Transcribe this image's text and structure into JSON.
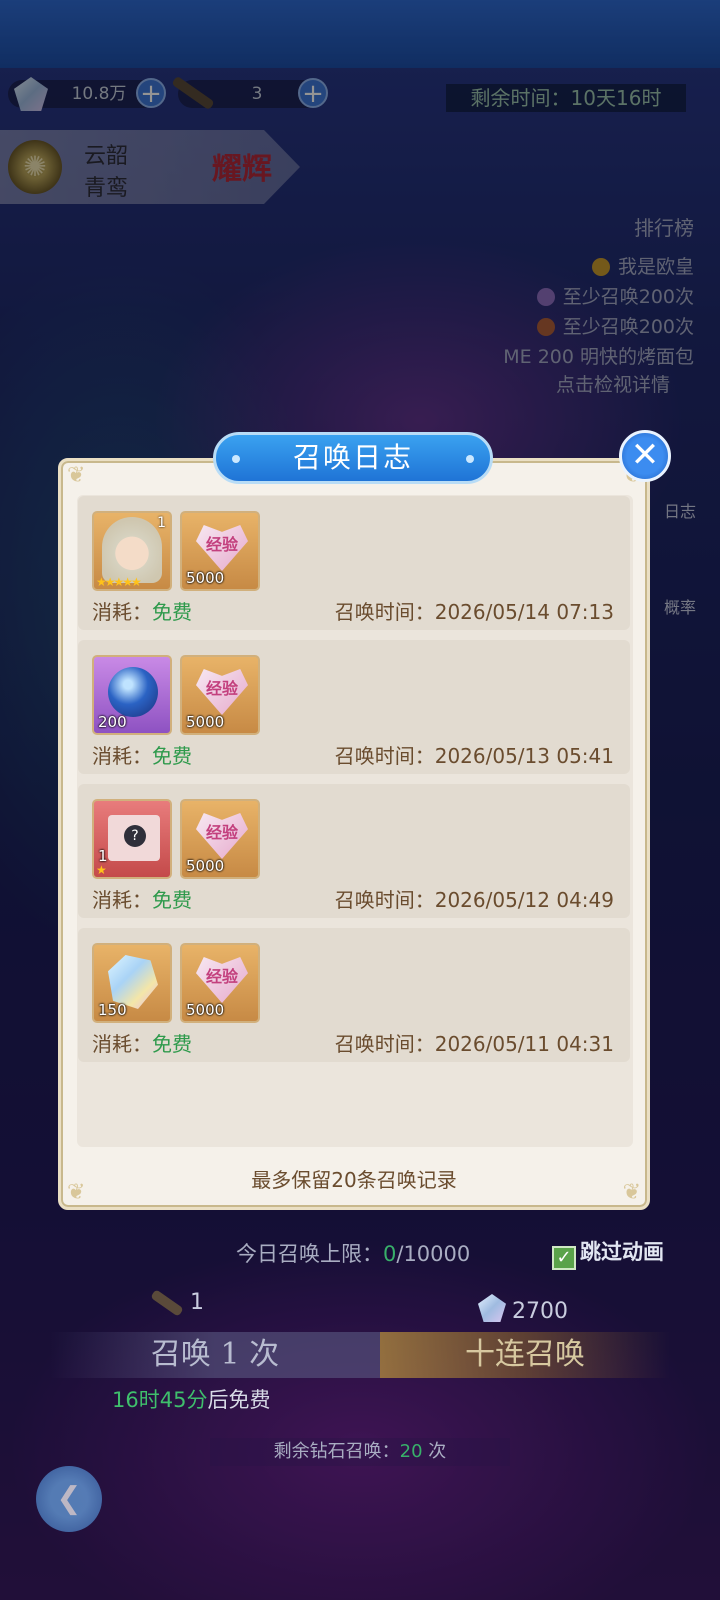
{
  "header": {
    "currency": [
      {
        "icon": "diamond-icon",
        "value": "10.8万"
      },
      {
        "icon": "summon-stick-icon",
        "value": "3"
      }
    ],
    "remaining_time_label": "剩余时间：",
    "remaining_time_value": "10天16时"
  },
  "server": {
    "line1": "云韶",
    "line2": "青鸾",
    "tag": "耀辉"
  },
  "ranking": {
    "title": "排行榜",
    "items": [
      "我是欧皇",
      "至少召唤200次",
      "至少召唤200次"
    ],
    "entry": "ME 200  明快的烤面包",
    "link": "点击检视详情"
  },
  "side_buttons": [
    "日志",
    "概率"
  ],
  "dialog": {
    "title": "召唤日志",
    "cost_label": "消耗：",
    "cost_value": "免费",
    "time_label": "召唤时间：",
    "entries": [
      {
        "items": [
          {
            "icon": "hero-portrait-icon",
            "count": "1",
            "stars": "★★★★★"
          },
          {
            "icon": "exp-heart-icon",
            "label": "经验",
            "count": "5000"
          }
        ],
        "time": "2026/05/14 07:13"
      },
      {
        "items": [
          {
            "icon": "crystal-orb-icon",
            "count": "200"
          },
          {
            "icon": "exp-heart-icon",
            "label": "经验",
            "count": "5000"
          }
        ],
        "time": "2026/05/13 05:41"
      },
      {
        "items": [
          {
            "icon": "mystery-box-icon",
            "count": "1",
            "stars": "★"
          },
          {
            "icon": "exp-heart-icon",
            "label": "经验",
            "count": "5000"
          }
        ],
        "time": "2026/05/12 04:49"
      },
      {
        "items": [
          {
            "icon": "diamond-crystal-icon",
            "count": "150"
          },
          {
            "icon": "exp-heart-icon",
            "label": "经验",
            "count": "5000"
          }
        ],
        "time": "2026/05/11 04:31"
      }
    ],
    "footer": "最多保留20条召唤记录"
  },
  "bottom": {
    "limit_label": "今日召唤上限：",
    "limit_used": "0",
    "limit_total": "/10000",
    "skip_label": "跳过动画",
    "stick_cost": "1",
    "diamond_cost": "2700",
    "summon_one": "召唤 1 次",
    "summon_ten": "十连召唤",
    "free_time": "16时45分",
    "free_suffix": "后免费",
    "remaining_label": "剩余钻石召唤：",
    "remaining_count": "20",
    "remaining_unit": " 次"
  }
}
